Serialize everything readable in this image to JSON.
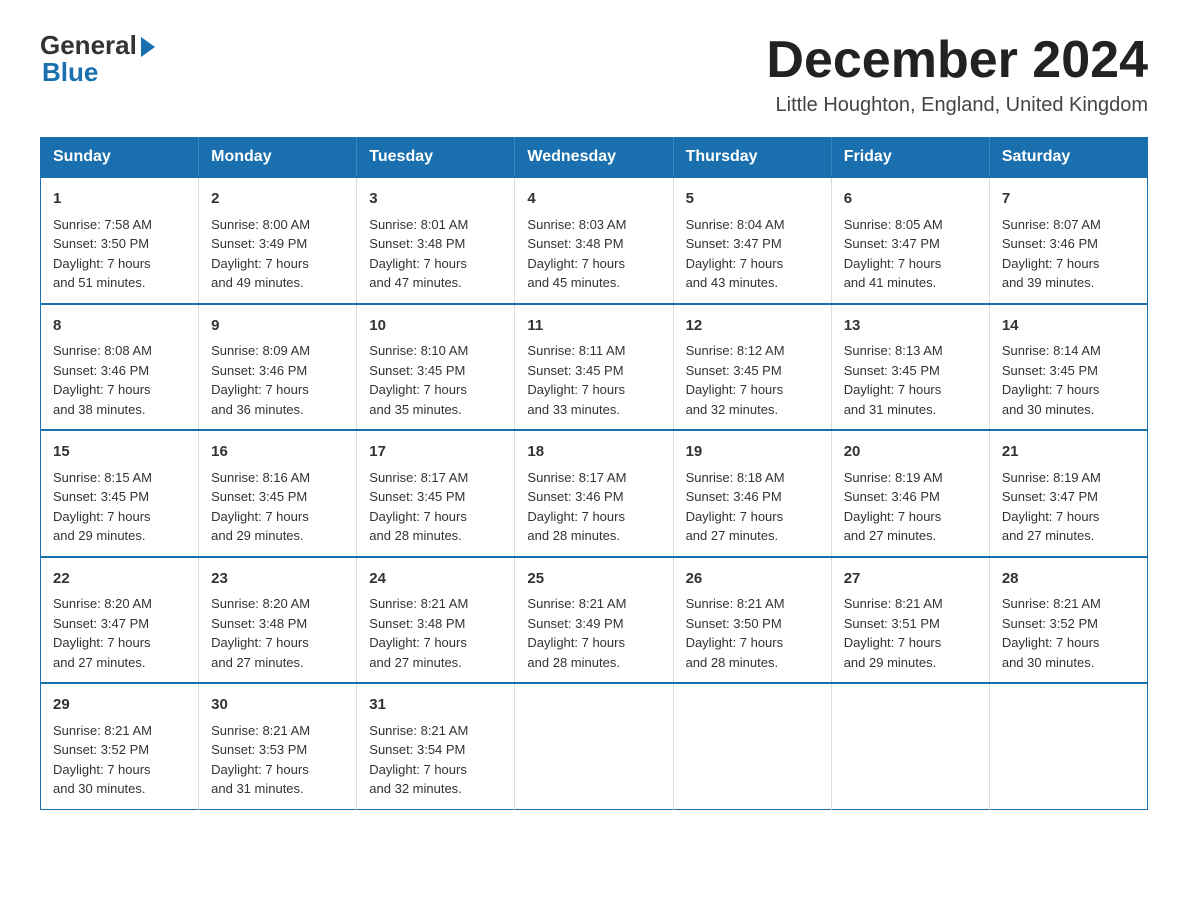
{
  "logo": {
    "general": "General",
    "blue": "Blue"
  },
  "title": "December 2024",
  "location": "Little Houghton, England, United Kingdom",
  "days_of_week": [
    "Sunday",
    "Monday",
    "Tuesday",
    "Wednesday",
    "Thursday",
    "Friday",
    "Saturday"
  ],
  "weeks": [
    [
      {
        "day": "1",
        "sunrise": "7:58 AM",
        "sunset": "3:50 PM",
        "daylight": "7 hours and 51 minutes."
      },
      {
        "day": "2",
        "sunrise": "8:00 AM",
        "sunset": "3:49 PM",
        "daylight": "7 hours and 49 minutes."
      },
      {
        "day": "3",
        "sunrise": "8:01 AM",
        "sunset": "3:48 PM",
        "daylight": "7 hours and 47 minutes."
      },
      {
        "day": "4",
        "sunrise": "8:03 AM",
        "sunset": "3:48 PM",
        "daylight": "7 hours and 45 minutes."
      },
      {
        "day": "5",
        "sunrise": "8:04 AM",
        "sunset": "3:47 PM",
        "daylight": "7 hours and 43 minutes."
      },
      {
        "day": "6",
        "sunrise": "8:05 AM",
        "sunset": "3:47 PM",
        "daylight": "7 hours and 41 minutes."
      },
      {
        "day": "7",
        "sunrise": "8:07 AM",
        "sunset": "3:46 PM",
        "daylight": "7 hours and 39 minutes."
      }
    ],
    [
      {
        "day": "8",
        "sunrise": "8:08 AM",
        "sunset": "3:46 PM",
        "daylight": "7 hours and 38 minutes."
      },
      {
        "day": "9",
        "sunrise": "8:09 AM",
        "sunset": "3:46 PM",
        "daylight": "7 hours and 36 minutes."
      },
      {
        "day": "10",
        "sunrise": "8:10 AM",
        "sunset": "3:45 PM",
        "daylight": "7 hours and 35 minutes."
      },
      {
        "day": "11",
        "sunrise": "8:11 AM",
        "sunset": "3:45 PM",
        "daylight": "7 hours and 33 minutes."
      },
      {
        "day": "12",
        "sunrise": "8:12 AM",
        "sunset": "3:45 PM",
        "daylight": "7 hours and 32 minutes."
      },
      {
        "day": "13",
        "sunrise": "8:13 AM",
        "sunset": "3:45 PM",
        "daylight": "7 hours and 31 minutes."
      },
      {
        "day": "14",
        "sunrise": "8:14 AM",
        "sunset": "3:45 PM",
        "daylight": "7 hours and 30 minutes."
      }
    ],
    [
      {
        "day": "15",
        "sunrise": "8:15 AM",
        "sunset": "3:45 PM",
        "daylight": "7 hours and 29 minutes."
      },
      {
        "day": "16",
        "sunrise": "8:16 AM",
        "sunset": "3:45 PM",
        "daylight": "7 hours and 29 minutes."
      },
      {
        "day": "17",
        "sunrise": "8:17 AM",
        "sunset": "3:45 PM",
        "daylight": "7 hours and 28 minutes."
      },
      {
        "day": "18",
        "sunrise": "8:17 AM",
        "sunset": "3:46 PM",
        "daylight": "7 hours and 28 minutes."
      },
      {
        "day": "19",
        "sunrise": "8:18 AM",
        "sunset": "3:46 PM",
        "daylight": "7 hours and 27 minutes."
      },
      {
        "day": "20",
        "sunrise": "8:19 AM",
        "sunset": "3:46 PM",
        "daylight": "7 hours and 27 minutes."
      },
      {
        "day": "21",
        "sunrise": "8:19 AM",
        "sunset": "3:47 PM",
        "daylight": "7 hours and 27 minutes."
      }
    ],
    [
      {
        "day": "22",
        "sunrise": "8:20 AM",
        "sunset": "3:47 PM",
        "daylight": "7 hours and 27 minutes."
      },
      {
        "day": "23",
        "sunrise": "8:20 AM",
        "sunset": "3:48 PM",
        "daylight": "7 hours and 27 minutes."
      },
      {
        "day": "24",
        "sunrise": "8:21 AM",
        "sunset": "3:48 PM",
        "daylight": "7 hours and 27 minutes."
      },
      {
        "day": "25",
        "sunrise": "8:21 AM",
        "sunset": "3:49 PM",
        "daylight": "7 hours and 28 minutes."
      },
      {
        "day": "26",
        "sunrise": "8:21 AM",
        "sunset": "3:50 PM",
        "daylight": "7 hours and 28 minutes."
      },
      {
        "day": "27",
        "sunrise": "8:21 AM",
        "sunset": "3:51 PM",
        "daylight": "7 hours and 29 minutes."
      },
      {
        "day": "28",
        "sunrise": "8:21 AM",
        "sunset": "3:52 PM",
        "daylight": "7 hours and 30 minutes."
      }
    ],
    [
      {
        "day": "29",
        "sunrise": "8:21 AM",
        "sunset": "3:52 PM",
        "daylight": "7 hours and 30 minutes."
      },
      {
        "day": "30",
        "sunrise": "8:21 AM",
        "sunset": "3:53 PM",
        "daylight": "7 hours and 31 minutes."
      },
      {
        "day": "31",
        "sunrise": "8:21 AM",
        "sunset": "3:54 PM",
        "daylight": "7 hours and 32 minutes."
      },
      null,
      null,
      null,
      null
    ]
  ],
  "labels": {
    "sunrise": "Sunrise:",
    "sunset": "Sunset:",
    "daylight": "Daylight:"
  }
}
